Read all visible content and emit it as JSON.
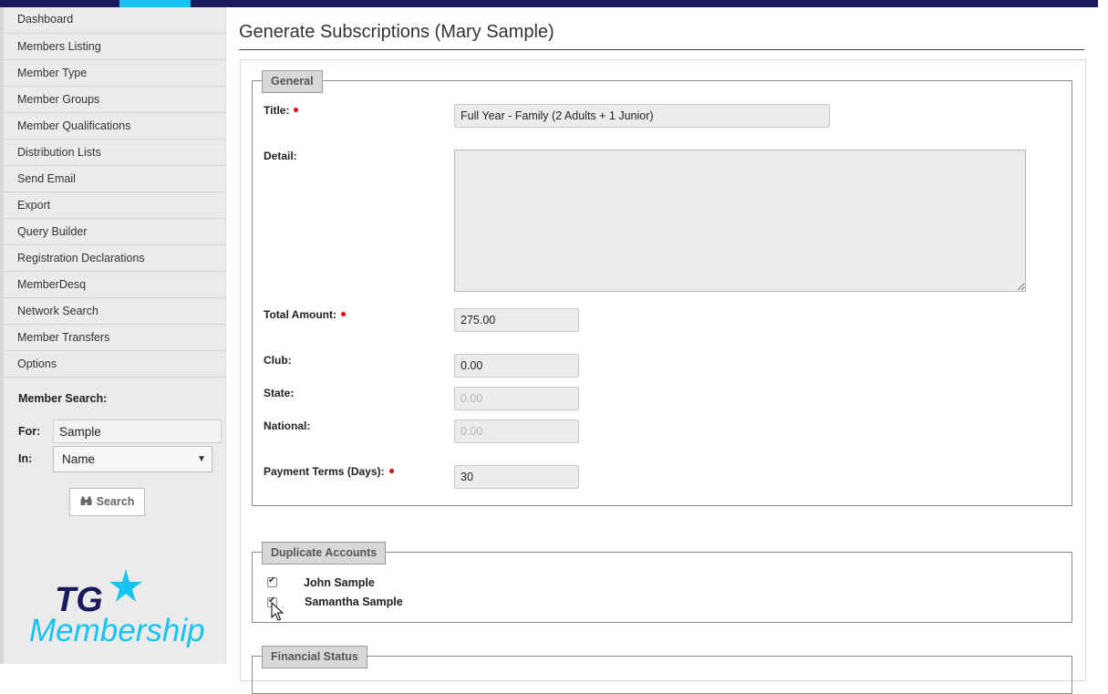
{
  "nav": {
    "items": [
      {
        "label": "Dashboard"
      },
      {
        "label": "Members Listing"
      },
      {
        "label": "Member Type"
      },
      {
        "label": "Member Groups"
      },
      {
        "label": "Member Qualifications"
      },
      {
        "label": "Distribution Lists"
      },
      {
        "label": "Send Email"
      },
      {
        "label": "Export"
      },
      {
        "label": "Query Builder"
      },
      {
        "label": "Registration Declarations"
      },
      {
        "label": "MemberDesq"
      },
      {
        "label": "Network Search"
      },
      {
        "label": "Member Transfers"
      },
      {
        "label": "Options"
      }
    ]
  },
  "member_search": {
    "title": "Member Search:",
    "for_label": "For:",
    "for_value": "Sample",
    "in_label": "In:",
    "in_value": "Name",
    "button_label": "Search",
    "button_icon": "binoculars-icon"
  },
  "logo": {
    "line1": "TG",
    "line2": "Membership",
    "colors": {
      "dark": "#1a1a5a",
      "accent": "#17c4ef"
    }
  },
  "page": {
    "title": "Generate Subscriptions (Mary Sample)"
  },
  "general": {
    "legend": "General",
    "title_label": "Title:",
    "title_value": "Full Year - Family (2 Adults + 1 Junior)",
    "detail_label": "Detail:",
    "detail_value": "",
    "total_label": "Total Amount:",
    "total_value": "275.00",
    "club_label": "Club:",
    "club_value": "0.00",
    "state_label": "State:",
    "state_value": "0.00",
    "national_label": "National:",
    "national_value": "0.00",
    "terms_label": "Payment Terms (Days):",
    "terms_value": "30"
  },
  "duplicate_accounts": {
    "legend": "Duplicate Accounts",
    "accounts": [
      {
        "name": "John Sample",
        "checked": true
      },
      {
        "name": "Samantha Sample",
        "checked": true
      }
    ]
  },
  "financial_status": {
    "legend": "Financial Status"
  },
  "colors": {
    "required": "#e00000",
    "accent": "#17c4ef",
    "brand_dark": "#1a1a5a"
  }
}
